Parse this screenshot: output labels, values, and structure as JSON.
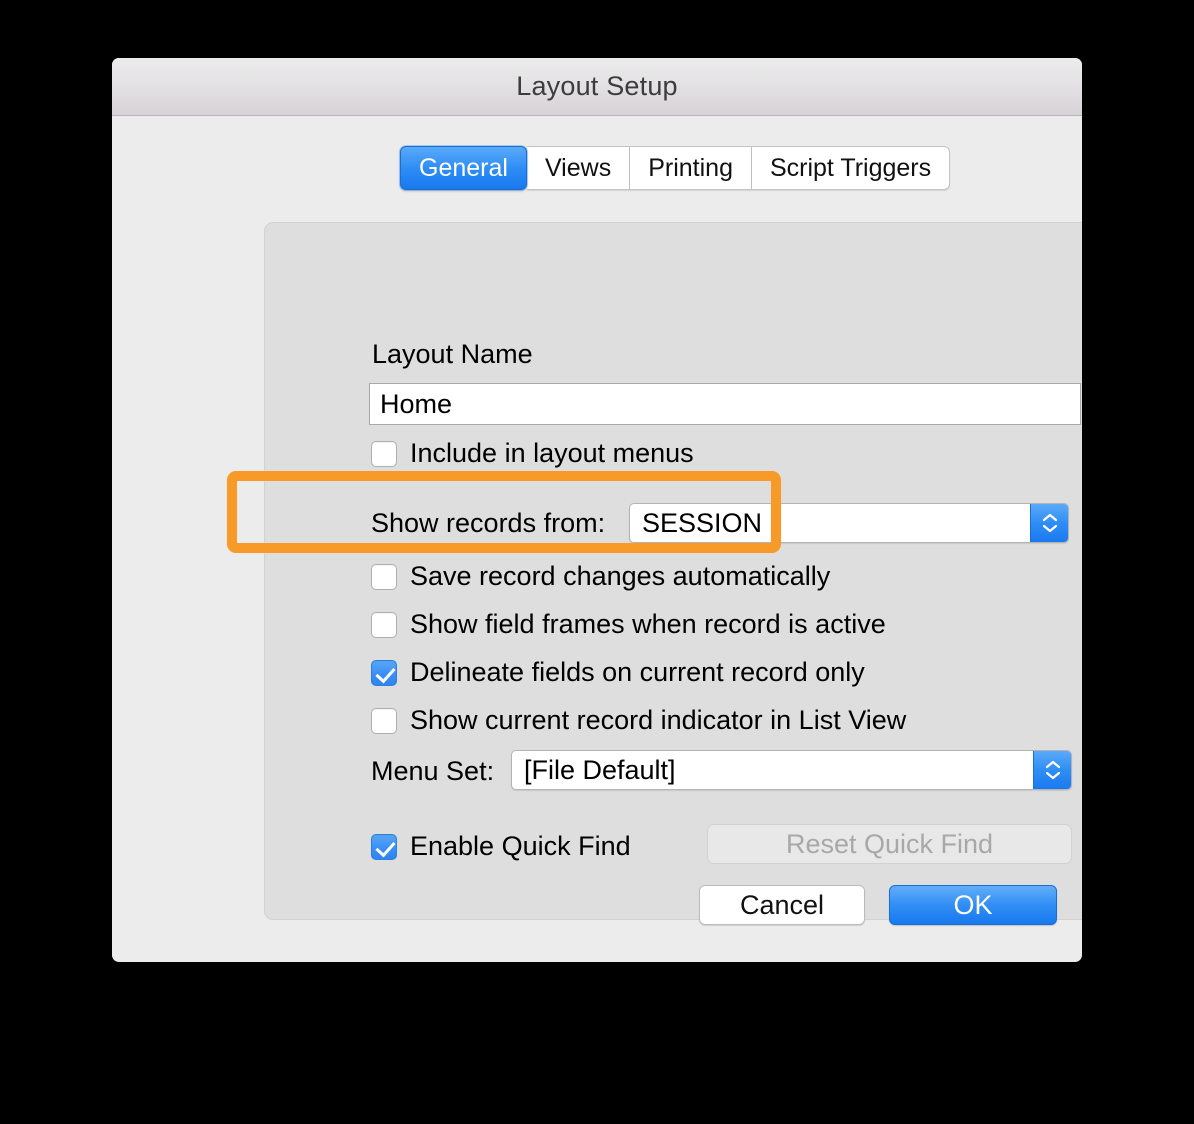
{
  "window": {
    "title": "Layout Setup"
  },
  "tabs": [
    {
      "label": "General",
      "active": true
    },
    {
      "label": "Views",
      "active": false
    },
    {
      "label": "Printing",
      "active": false
    },
    {
      "label": "Script Triggers",
      "active": false
    }
  ],
  "general": {
    "layout_name_label": "Layout Name",
    "layout_name_value": "Home",
    "layout_name_placeholder": "Layout Name",
    "include_in_layout_menus": {
      "label": "Include in layout menus",
      "checked": false
    },
    "show_records_from_label": "Show records from:",
    "show_records_from_value": "SESSION",
    "checkboxes": [
      {
        "label": "Save record changes automatically",
        "checked": false,
        "highlighted": true
      },
      {
        "label": "Show field frames when record is active",
        "checked": false,
        "highlighted": false
      },
      {
        "label": "Delineate fields on current record only",
        "checked": true,
        "highlighted": false
      },
      {
        "label": "Show current record indicator in List View",
        "checked": false,
        "highlighted": false
      }
    ],
    "menu_set_label": "Menu Set:",
    "menu_set_value": "[File Default]",
    "enable_quick_find": {
      "label": "Enable Quick Find",
      "checked": true
    },
    "reset_quick_find_label": "Reset Quick Find"
  },
  "footer": {
    "cancel_label": "Cancel",
    "ok_label": "OK"
  },
  "icons": {
    "stepper_up": "chevron-up-icon",
    "stepper_down": "chevron-down-icon"
  },
  "colors": {
    "accent_blue": "#3b8ff5",
    "highlight_orange": "#f79a28",
    "window_background": "#ececec",
    "panel_background": "#dedede",
    "title_text": "#3c3c3c",
    "disabled_text": "#a8a8a8"
  }
}
